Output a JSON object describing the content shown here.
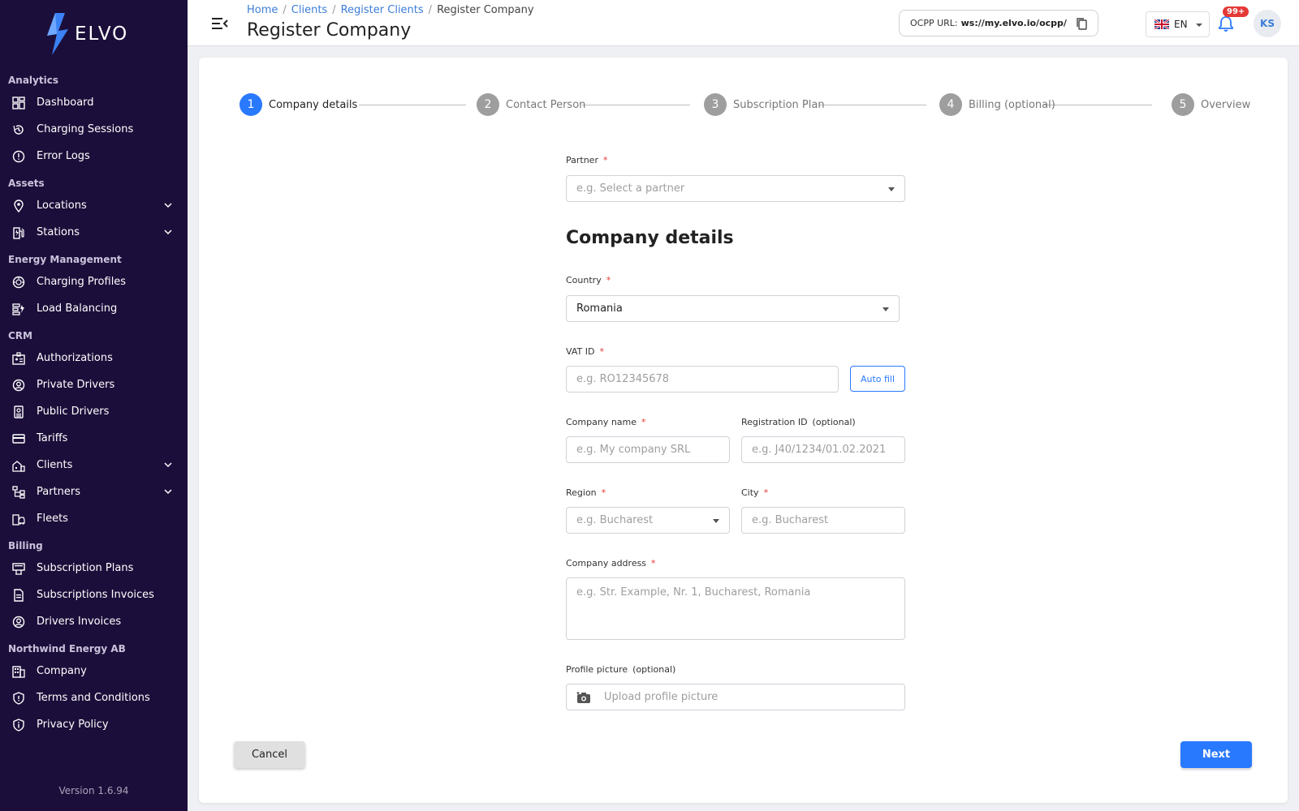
{
  "brand": {
    "name": "ELVO",
    "accent": "#2979ff",
    "sidebar_bg": "#1c0e3a"
  },
  "sidebar": {
    "sections": [
      {
        "title": "Analytics",
        "items": [
          {
            "label": "Dashboard",
            "icon": "dashboard-icon"
          },
          {
            "label": "Charging Sessions",
            "icon": "history-icon"
          },
          {
            "label": "Error Logs",
            "icon": "error-icon"
          }
        ]
      },
      {
        "title": "Assets",
        "items": [
          {
            "label": "Locations",
            "icon": "location-pin-icon",
            "expandable": true
          },
          {
            "label": "Stations",
            "icon": "ev-station-icon",
            "expandable": true
          }
        ]
      },
      {
        "title": "Energy Management",
        "items": [
          {
            "label": "Charging Profiles",
            "icon": "speed-icon"
          },
          {
            "label": "Load Balancing",
            "icon": "balance-icon"
          }
        ]
      },
      {
        "title": "CRM",
        "items": [
          {
            "label": "Authorizations",
            "icon": "badge-icon"
          },
          {
            "label": "Private Drivers",
            "icon": "user-circle-icon"
          },
          {
            "label": "Public Drivers",
            "icon": "id-card-icon"
          },
          {
            "label": "Tariffs",
            "icon": "credit-card-icon"
          },
          {
            "label": "Clients",
            "icon": "clients-icon",
            "expandable": true
          },
          {
            "label": "Partners",
            "icon": "hierarchy-icon",
            "expandable": true
          },
          {
            "label": "Fleets",
            "icon": "fleet-icon"
          }
        ]
      },
      {
        "title": "Billing",
        "items": [
          {
            "label": "Subscription Plans",
            "icon": "plans-icon"
          },
          {
            "label": "Subscriptions Invoices",
            "icon": "invoice-icon"
          },
          {
            "label": "Drivers Invoices",
            "icon": "user-circle-icon"
          }
        ]
      },
      {
        "title": "Northwind Energy AB",
        "items": [
          {
            "label": "Company",
            "icon": "building-icon"
          },
          {
            "label": "Terms and Conditions",
            "icon": "shield-icon"
          },
          {
            "label": "Privacy Policy",
            "icon": "shield-check-icon"
          }
        ]
      }
    ],
    "version": "Version 1.6.94"
  },
  "header": {
    "breadcrumb": [
      "Home",
      "Clients",
      "Register Clients"
    ],
    "breadcrumb_current": "Register Company",
    "title": "Register Company",
    "ocpp_label": "OCPP URL:",
    "ocpp_url": "ws://my.elvo.io/ocpp/",
    "language": "EN",
    "notifications": "99+",
    "avatar_initials": "KS"
  },
  "stepper": [
    {
      "num": "1",
      "label": "Company details",
      "active": true
    },
    {
      "num": "2",
      "label": "Contact Person",
      "active": false
    },
    {
      "num": "3",
      "label": "Subscription Plan",
      "active": false
    },
    {
      "num": "4",
      "label": "Billing (optional)",
      "active": false
    },
    {
      "num": "5",
      "label": "Overview",
      "active": false
    }
  ],
  "form": {
    "partner_label": "Partner",
    "partner_placeholder": "e.g. Select a partner",
    "section_title": "Company details",
    "country_label": "Country",
    "country_value": "Romania",
    "vat_label": "VAT ID",
    "vat_placeholder": "e.g. RO12345678",
    "autofill_label": "Auto fill",
    "company_name_label": "Company name",
    "company_name_placeholder": "e.g. My company SRL",
    "registration_label": "Registration ID",
    "registration_optional": "(optional)",
    "registration_placeholder": "e.g. J40/1234/01.02.2021",
    "region_label": "Region",
    "region_placeholder": "e.g. Bucharest",
    "city_label": "City",
    "city_placeholder": "e.g. Bucharest",
    "address_label": "Company address",
    "address_placeholder": "e.g. Str. Example, Nr. 1, Bucharest, Romania",
    "picture_label": "Profile picture",
    "picture_optional": "(optional)",
    "picture_placeholder": "Upload profile picture",
    "required_mark": "*"
  },
  "actions": {
    "cancel": "Cancel",
    "next": "Next"
  }
}
